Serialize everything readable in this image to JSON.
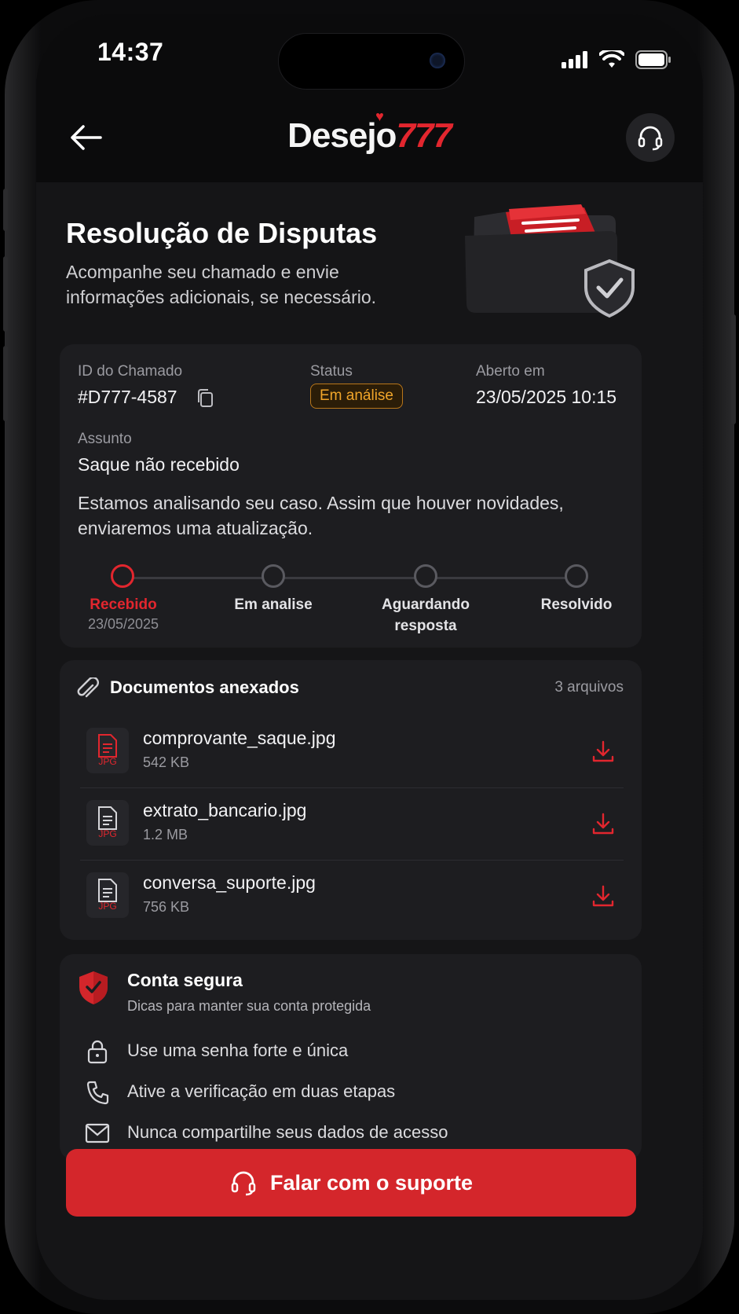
{
  "status_bar": {
    "time": "14:37"
  },
  "header": {
    "logo_main": "Desejo",
    "logo_accent": "777"
  },
  "hero": {
    "title": "Resolução de Disputas",
    "subtitle": "Acompanhe seu chamado e envie informações adicionais, se necessário."
  },
  "ticket": {
    "id_label": "ID do Chamado",
    "id_value": "#D777-4587",
    "status_label": "Status",
    "status_value": "Em análise",
    "opened_label": "Aberto em",
    "opened_value": "23/05/2025 10:15",
    "subject_label": "Assunto",
    "subject_value": "Saque não recebido",
    "description": "Estamos analisando seu caso. Assim que houver novidades, enviaremos uma atualização."
  },
  "timeline": {
    "steps": [
      {
        "label": "Recebido",
        "date": "23/05/2025"
      },
      {
        "label": "Em analise"
      },
      {
        "label": "Aguardando resposta"
      },
      {
        "label": "Resolvido"
      }
    ]
  },
  "documents": {
    "title": "Documentos anexados",
    "count": "3 arquivos",
    "files": [
      {
        "name": "comprovante_saque.jpg",
        "size": "542 KB",
        "ext": "JPG"
      },
      {
        "name": "extrato_bancario.jpg",
        "size": "1.2 MB",
        "ext": "JPG"
      },
      {
        "name": "conversa_suporte.jpg",
        "size": "756 KB",
        "ext": "JPG"
      }
    ]
  },
  "security": {
    "title": "Conta segura",
    "subtitle": "Dicas para manter sua conta protegida",
    "tips": [
      {
        "text": "Use uma senha forte e única",
        "icon": "lock-icon"
      },
      {
        "text": "Ative a verificação em duas etapas",
        "icon": "phone-icon"
      },
      {
        "text": "Nunca compartilhe seus dados de acesso",
        "icon": "mail-icon"
      }
    ]
  },
  "cta": {
    "label": "Falar com o suporte"
  },
  "colors": {
    "accent": "#e2262e",
    "status_warning": "#f0a52a",
    "background": "#151517",
    "card": "#1d1d20"
  }
}
